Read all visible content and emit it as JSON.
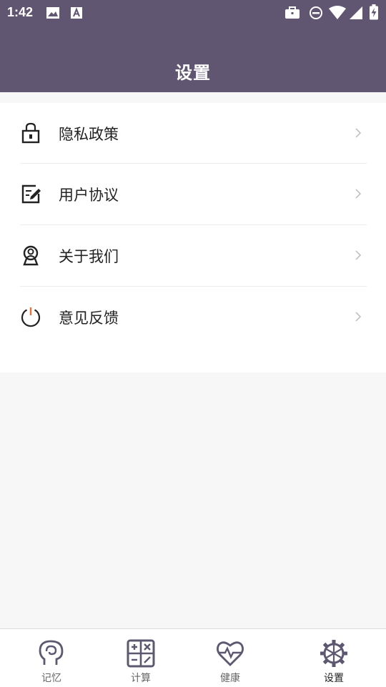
{
  "status_bar": {
    "time": "1:42",
    "left_icons": [
      "image-icon",
      "a-box-icon"
    ],
    "right_icons": [
      "briefcase-icon",
      "do-not-disturb-icon",
      "wifi-icon",
      "cell-signal-icon",
      "battery-charging-icon"
    ]
  },
  "header": {
    "title": "设置"
  },
  "menu": {
    "items": [
      {
        "label": "隐私政策",
        "icon": "lock-icon"
      },
      {
        "label": "用户协议",
        "icon": "edit-document-icon"
      },
      {
        "label": "关于我们",
        "icon": "profile-icon"
      },
      {
        "label": "意见反馈",
        "icon": "power-icon"
      }
    ]
  },
  "tabbar": {
    "tabs": [
      {
        "label": "记忆",
        "icon": "brain-head-icon",
        "active": false
      },
      {
        "label": "计算",
        "icon": "calculator-icon",
        "active": false
      },
      {
        "label": "健康",
        "icon": "heartbeat-icon",
        "active": false
      },
      {
        "label": "设置",
        "icon": "gear-icon",
        "active": true
      }
    ]
  },
  "colors": {
    "header_bg": "#615671",
    "icon_accent": "#5d5770",
    "power_accent": "#e6733c",
    "page_bg": "#f7f7f7"
  }
}
